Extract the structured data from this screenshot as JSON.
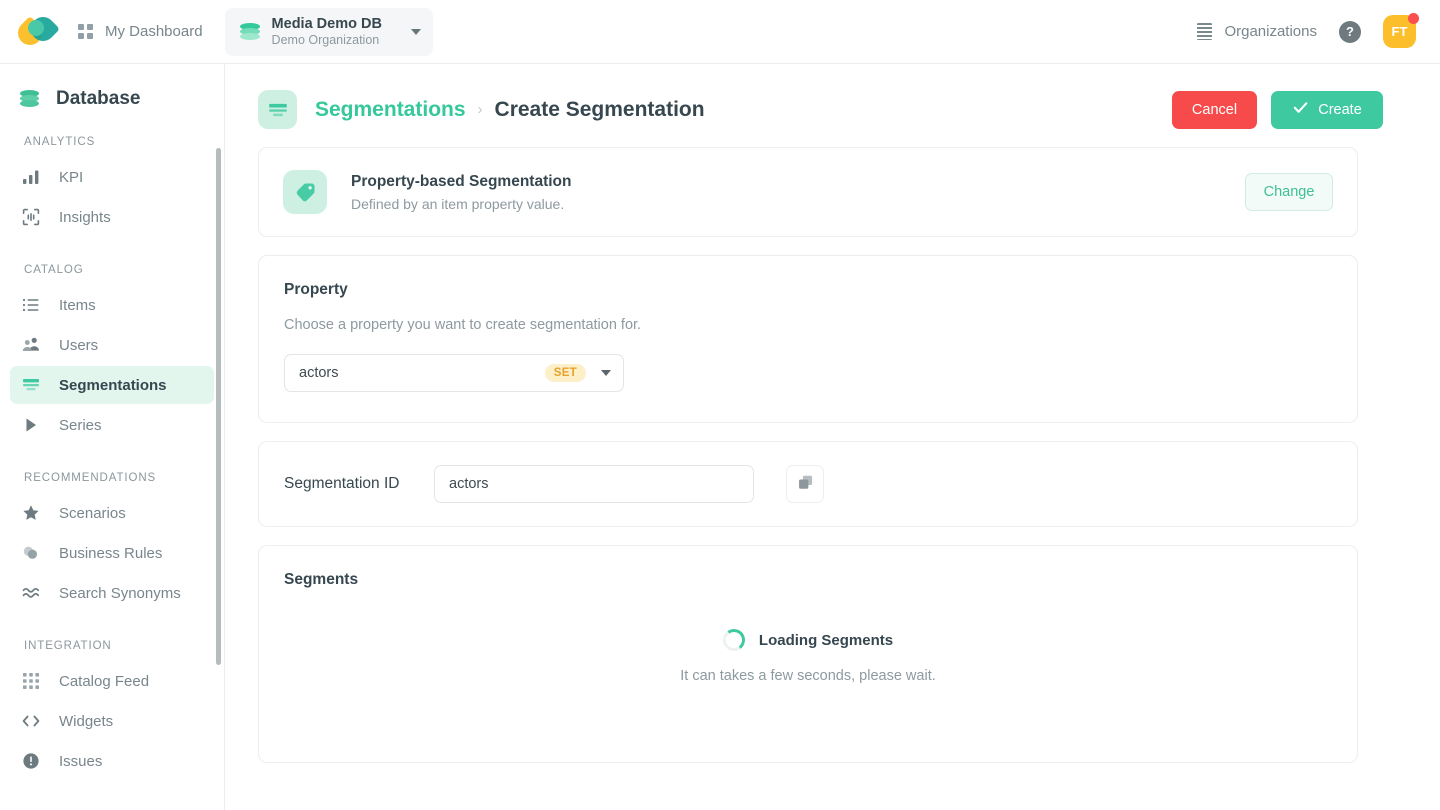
{
  "topbar": {
    "logo_name": "app-logo",
    "dashboard_label": "My Dashboard",
    "database": {
      "name": "Media Demo DB",
      "organization": "Demo Organization"
    },
    "organizations_label": "Organizations",
    "help_label": "?",
    "avatar_initials": "FT"
  },
  "sidebar": {
    "header": "Database",
    "sections": [
      {
        "title": "ANALYTICS",
        "items": [
          {
            "label": "KPI",
            "icon": "bar-chart-icon",
            "active": false
          },
          {
            "label": "Insights",
            "icon": "insights-icon",
            "active": false
          }
        ]
      },
      {
        "title": "CATALOG",
        "items": [
          {
            "label": "Items",
            "icon": "list-icon",
            "active": false
          },
          {
            "label": "Users",
            "icon": "users-icon",
            "active": false
          },
          {
            "label": "Segmentations",
            "icon": "segmentations-icon",
            "active": true
          },
          {
            "label": "Series",
            "icon": "play-icon",
            "active": false
          }
        ]
      },
      {
        "title": "RECOMMENDATIONS",
        "items": [
          {
            "label": "Scenarios",
            "icon": "star-icon",
            "active": false
          },
          {
            "label": "Business Rules",
            "icon": "business-rules-icon",
            "active": false
          },
          {
            "label": "Search Synonyms",
            "icon": "synonyms-icon",
            "active": false
          }
        ]
      },
      {
        "title": "INTEGRATION",
        "items": [
          {
            "label": "Catalog Feed",
            "icon": "catalog-feed-icon",
            "active": false
          },
          {
            "label": "Widgets",
            "icon": "code-icon",
            "active": false
          },
          {
            "label": "Issues",
            "icon": "issues-icon",
            "active": false
          }
        ]
      }
    ]
  },
  "page": {
    "breadcrumb_parent": "Segmentations",
    "breadcrumb_separator": "›",
    "breadcrumb_current": "Create Segmentation",
    "cancel_label": "Cancel",
    "create_label": "Create"
  },
  "type_card": {
    "icon": "tag-icon",
    "title": "Property-based Segmentation",
    "subtitle": "Defined by an item property value.",
    "change_label": "Change"
  },
  "property_section": {
    "title": "Property",
    "description": "Choose a property you want to create segmentation for.",
    "selected_value": "actors",
    "value_type_badge": "SET"
  },
  "segmentation_id_section": {
    "label": "Segmentation ID",
    "value": "actors",
    "placeholder": "",
    "copy_icon": "copy-icon"
  },
  "segments_section": {
    "title": "Segments",
    "loading_title": "Loading Segments",
    "loading_subtitle": "It can takes a few seconds, please wait."
  },
  "colors": {
    "accent_green": "#3fc9a1",
    "danger_red": "#f74b4b",
    "badge_amber": "#e8a22c",
    "avatar_amber": "#fdbe2b",
    "notification_red": "#f94f4f"
  }
}
